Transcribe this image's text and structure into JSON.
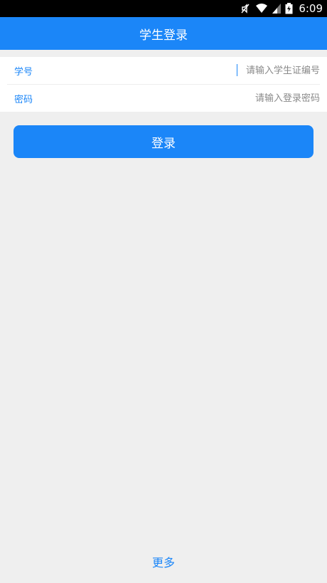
{
  "status_bar": {
    "time": "6:09",
    "icons": [
      "mute-icon",
      "wifi-icon",
      "signal-icon",
      "battery-icon"
    ]
  },
  "app_bar": {
    "title": "学生登录"
  },
  "form": {
    "student_id": {
      "label": "学号",
      "placeholder": "请输入学生证编号",
      "value": ""
    },
    "password": {
      "label": "密码",
      "placeholder": "请输入登录密码",
      "value": ""
    }
  },
  "login_button": {
    "label": "登录"
  },
  "footer": {
    "more_label": "更多"
  },
  "colors": {
    "accent": "#1b86f8",
    "background": "#efefef",
    "status_bar": "#000000"
  }
}
